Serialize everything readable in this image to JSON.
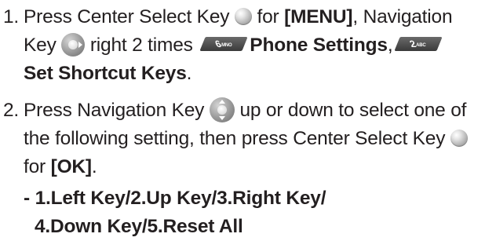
{
  "steps": [
    {
      "number": "1.",
      "line1_text_a": "Press Center Select Key",
      "line1_text_b": " for ",
      "line1_menu": "[MENU]",
      "line1_text_c": ", Navigation",
      "line2_text_a": "Key",
      "line2_text_b": " right 2 times ",
      "line2_key1_digit": "6",
      "line2_key1_letters": "MNO",
      "line2_link1": "Phone Settings",
      "line2_comma": ",",
      "line2_key2_digit": "2",
      "line2_key2_letters": "ABC",
      "line3_link2": "Set Shortcut Keys",
      "line3_period": "."
    },
    {
      "number": "2.",
      "line1_text_a": "Press Navigation Key",
      "line1_text_b": " up or down to select one of",
      "line2_text": "the following setting, then press Center Select Key",
      "line3_text_a": "for ",
      "line3_ok": "[OK]",
      "line3_period": ".",
      "options_line1": "- 1.Left Key/2.Up Key/3.Right Key/",
      "options_line2": "4.Down Key/5.Reset All"
    }
  ],
  "icons": {
    "center_select_key": "center-select-key-icon",
    "nav_right": "navigation-key-right-icon",
    "nav_up_down": "navigation-key-up-down-icon",
    "keycap_6": "keycap-6-icon",
    "keycap_2": "keycap-2-icon"
  }
}
